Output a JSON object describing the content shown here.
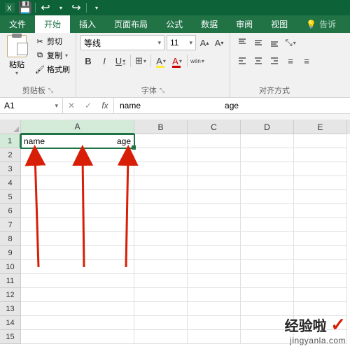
{
  "qat": {
    "save": "💾",
    "undo": "↩",
    "redo": "↪"
  },
  "tabs": {
    "file": "文件",
    "home": "开始",
    "insert": "插入",
    "layout": "页面布局",
    "formulas": "公式",
    "data": "数据",
    "review": "审阅",
    "view": "视图",
    "tell": "告诉"
  },
  "ribbon": {
    "clipboard": {
      "paste": "粘贴",
      "cut": "剪切",
      "copy": "复制",
      "format_painter": "格式刷",
      "label": "剪贴板"
    },
    "font": {
      "name": "等线",
      "size": "11",
      "bold": "B",
      "italic": "I",
      "underline": "U",
      "label": "字体"
    },
    "alignment": {
      "label": "对齐方式"
    }
  },
  "namebox": "A1",
  "formula": {
    "part1": "name",
    "part2": "age"
  },
  "columns": [
    "A",
    "B",
    "C",
    "D",
    "E"
  ],
  "rows": [
    "1",
    "2",
    "3",
    "4",
    "5",
    "6",
    "7",
    "8",
    "9",
    "10",
    "11",
    "12",
    "13",
    "14",
    "15"
  ],
  "cells": {
    "A1_left": "name",
    "A1_right": "age"
  },
  "watermark": {
    "brand": "经验啦",
    "check": "✓",
    "url": "jingyanla.com"
  }
}
